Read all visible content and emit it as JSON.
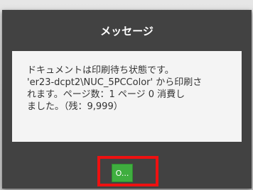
{
  "dialog": {
    "title": "メッセージ",
    "message": "ドキュメントは印刷待ち状態です。\n'er23-dcpt2\\NUC_5PCColor' から印刷さ\nれます。ページ数：1 ページ 0 消費し\nました。（残：9,999）",
    "ok_label": "O..."
  },
  "colors": {
    "dialog_bg": "#424242",
    "body_bg": "#f4f4f4",
    "button_green": "#3fae3f",
    "highlight_red": "#ee1111"
  }
}
